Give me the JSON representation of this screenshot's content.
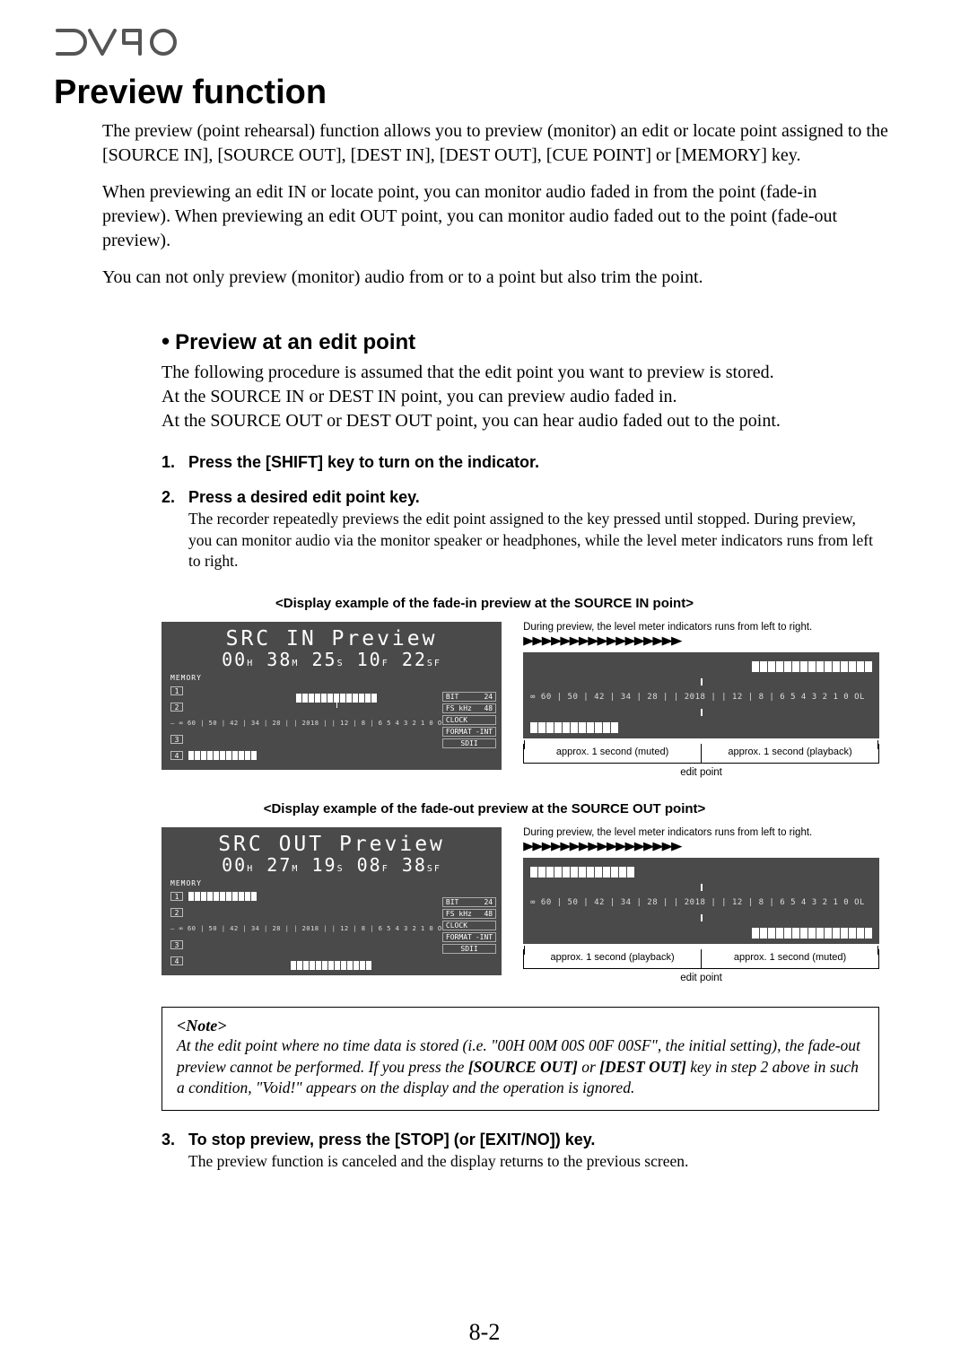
{
  "logo_text": "DV40",
  "title": "Preview function",
  "para1": "The preview (point rehearsal) function allows you to preview (monitor) an edit or locate point assigned to the [SOURCE IN], [SOURCE OUT],  [DEST IN], [DEST OUT], [CUE POINT] or [MEMORY] key.",
  "para2": "When previewing an edit IN or locate point, you can monitor audio faded in from the point (fade-in preview). When previewing an edit OUT point, you can monitor audio faded out to the point (fade-out preview).",
  "para3": "You can not only preview (monitor) audio from or to a point but also trim the point.",
  "subhead": "Preview at an edit point",
  "subpara": "The following procedure is assumed that the edit point you want to preview is stored.\nAt the SOURCE IN or DEST IN point, you can preview audio faded in.\nAt the SOURCE OUT or DEST OUT point, you can hear audio faded out to the point.",
  "step1": {
    "num": "1.",
    "head": "Press the [SHIFT] key to turn on the indicator."
  },
  "step2": {
    "num": "2.",
    "head": "Press a desired edit point key.",
    "body": "The recorder repeatedly previews the edit point assigned to the key pressed until stopped. During preview, you can monitor audio via the monitor speaker or headphones, while the level meter indicators runs from left to right."
  },
  "caption_in": "<Display example of the fade-in preview at the SOURCE IN point>",
  "caption_out": "<Display example of the fade-out preview at the SOURCE OUT point>",
  "lcd_in": {
    "line1": "SRC IN Preview",
    "time": "00H 38M 25S 10F 22SF",
    "memory": "MEMORY",
    "scale": "— ∞ 60 | 50 | 42 | 34 | 28 |  | 2018 |  | 12 |  8 |  6  5  4  3  2  1  0 OL",
    "tags": {
      "bit": "BIT",
      "bitv": "24",
      "fs": "FS kHz",
      "fsv": "48",
      "clk": "CLOCK",
      "clkv": "-INT",
      "fmt": "FORMAT",
      "sd": "SDII"
    }
  },
  "lcd_out": {
    "line1": "SRC OUT Preview",
    "time": "00H 27M 19S 08F 38SF",
    "memory": "MEMORY",
    "scale": "— ∞ 60 | 50 | 42 | 34 | 28 |  | 2018 |  | 12 |  8 |  6  5  4  3  2  1  0 OL",
    "tags": {
      "bit": "BIT",
      "bitv": "24",
      "fs": "FS kHz",
      "fsv": "48",
      "clk": "CLOCK",
      "clkv": "-INT",
      "fmt": "FORMAT",
      "sd": "SDII"
    }
  },
  "detail": {
    "caption": "During preview, the level meter indicators runs from left to right.",
    "scale": "∞ 60 | 50 | 42 | 34 | 28 |  | 2018 |  | 12 |  8 |  6  5  4  3  2  1  0 OL",
    "in": {
      "left": "approx. 1 second (muted)",
      "right": "approx. 1 second (playback)"
    },
    "out": {
      "left": "approx. 1 second (playback)",
      "right": "approx. 1 second (muted)"
    },
    "edit_label": "edit point"
  },
  "note": {
    "title": "<Note>",
    "body_pre": "At the edit point where no time data is stored (i.e. \"00H 00M 00S 00F 00SF\", the initial setting), the fade-out preview cannot be performed.  If you press the ",
    "key1": "[SOURCE OUT]",
    "mid": " or ",
    "key2": "[DEST OUT]",
    "body_post": " key in step 2 above in such a condition, \"Void!\" appears on the display and the operation is ignored."
  },
  "step3": {
    "num": "3.",
    "head": "To stop preview, press the [STOP] (or [EXIT/NO]) key.",
    "body": "The preview function is canceled and the display returns to the previous screen."
  },
  "page": "8-2"
}
